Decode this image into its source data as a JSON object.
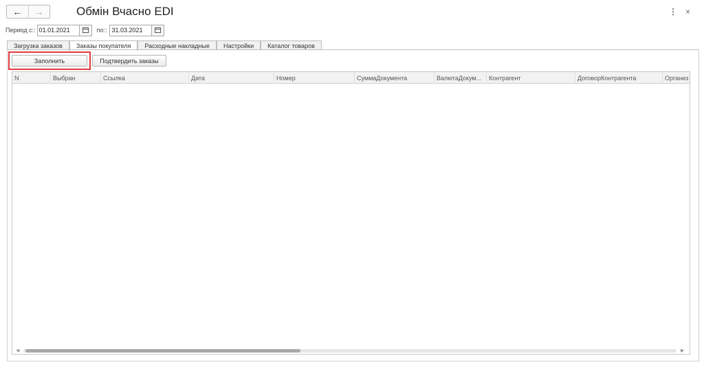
{
  "window": {
    "title": "Обмін Вчасно EDI",
    "back_icon": "arrow-left-icon",
    "forward_icon": "arrow-right-icon",
    "more_glyph": "⋮",
    "close_glyph": "×"
  },
  "period": {
    "from_label": "Период с::",
    "from_value": "01.01.2021",
    "to_label": "по::",
    "to_value": "31.03.2021"
  },
  "tabs": [
    {
      "label": "Загрузка заказов",
      "active": false
    },
    {
      "label": "Заказы покупателя",
      "active": true
    },
    {
      "label": "Расходные накладные",
      "active": false
    },
    {
      "label": "Настройки",
      "active": false
    },
    {
      "label": "Каталог товаров",
      "active": false
    }
  ],
  "toolbar": {
    "fill_label": "Заполнить",
    "confirm_label": "Подтвердить заказы",
    "highlight_color": "#e0383e"
  },
  "table": {
    "columns": [
      "N",
      "Выбран",
      "Ссылка",
      "Дата",
      "Номер",
      "СуммаДокумента",
      "ВалютаДокум...",
      "Контрагент",
      "ДоговорКонтрагента",
      "Организ"
    ],
    "rows": []
  }
}
